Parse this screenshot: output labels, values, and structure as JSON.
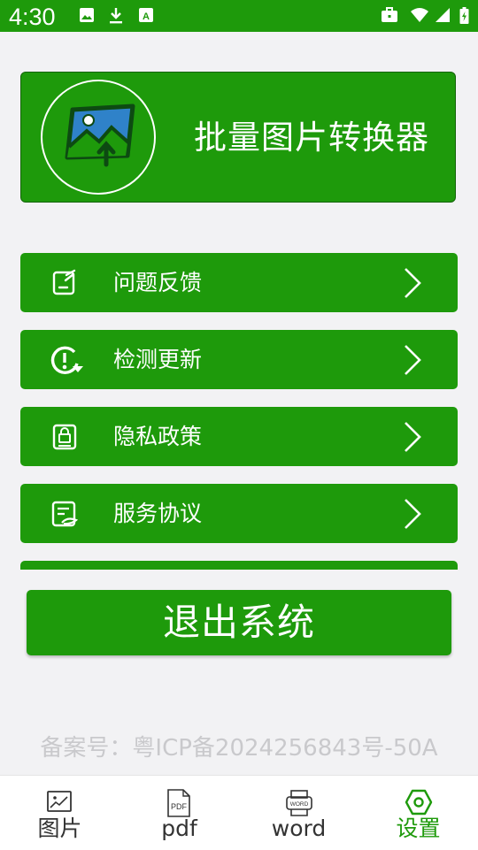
{
  "status_bar": {
    "time": "4:30",
    "left_icons": [
      "image-icon",
      "download-icon",
      "font-a-icon"
    ],
    "right_icons": [
      "briefcase-icon",
      "wifi-icon",
      "signal-icon",
      "battery-icon"
    ]
  },
  "header": {
    "title": "批量图片转换器",
    "logo_icon": "image-upload-icon"
  },
  "menu": {
    "items": [
      {
        "label": "问题反馈",
        "icon": "feedback-icon"
      },
      {
        "label": "检测更新",
        "icon": "update-icon"
      },
      {
        "label": "隐私政策",
        "icon": "privacy-icon"
      },
      {
        "label": "服务协议",
        "icon": "agreement-icon"
      }
    ]
  },
  "logout_label": "退出系统",
  "icp_text": "备案号：粤ICP备2024256843号-50A",
  "bottom_nav": {
    "tabs": [
      {
        "label": "图片",
        "icon": "picture-icon",
        "active": false
      },
      {
        "label": "pdf",
        "icon": "pdf-file-icon",
        "active": false
      },
      {
        "label": "word",
        "icon": "word-file-icon",
        "active": false
      },
      {
        "label": "设置",
        "icon": "settings-hex-icon",
        "active": true
      }
    ]
  },
  "colors": {
    "primary": "#1e9a0b",
    "background": "#f2f2f4",
    "text_inactive": "#333333",
    "icp_text": "#c9c9cc"
  }
}
